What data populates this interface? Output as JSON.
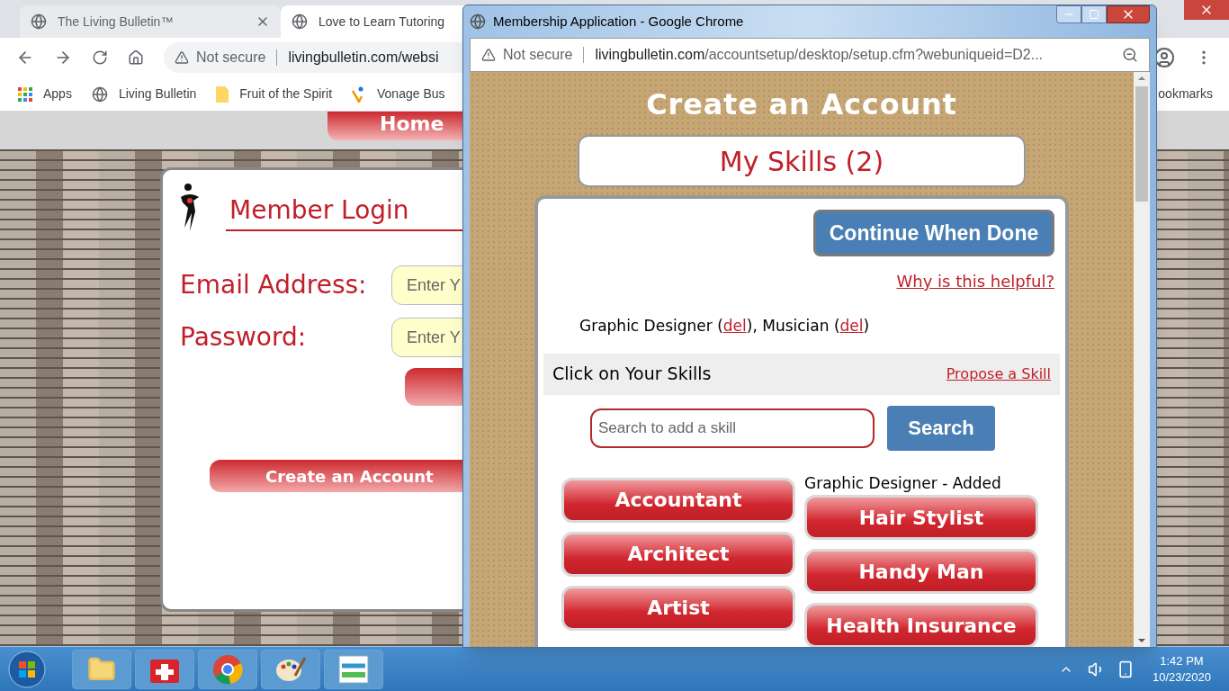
{
  "background_browser": {
    "tabs": [
      {
        "title": "The Living Bulletin™",
        "selected": false
      },
      {
        "title": "Love to Learn Tutoring",
        "selected": true
      }
    ],
    "address_bar": {
      "security": "Not secure",
      "url": "livingbulletin.com/websi"
    },
    "bookmarks": [
      {
        "label": "Apps",
        "kind": "apps"
      },
      {
        "label": "Living Bulletin",
        "kind": "globe"
      },
      {
        "label": "Fruit of the Spirit",
        "kind": "folder"
      },
      {
        "label": "Vonage Bus",
        "kind": "vonage"
      }
    ],
    "other_bookmarks": "ookmarks"
  },
  "background_page": {
    "nav_tab": "Home",
    "login": {
      "title": "Member Login",
      "fields": [
        {
          "label": "Email Address:",
          "placeholder": "Enter Y"
        },
        {
          "label": "Password:",
          "placeholder": "Enter Y"
        }
      ],
      "create_button": "Create an Account"
    }
  },
  "popup": {
    "title": "Membership Application - Google Chrome",
    "address_bar": {
      "security": "Not secure",
      "host": "livingbulletin.com",
      "path": "/accountsetup/desktop/setup.cfm?webuniqueid=D2..."
    },
    "heading": "Create an Account",
    "section_title": "My Skills (2)",
    "continue_button": "Continue When Done",
    "help_link": "Why is this helpful?",
    "selected_skills": [
      {
        "kind": "text",
        "text": "Graphic Designer ("
      },
      {
        "kind": "link",
        "text": "del"
      },
      {
        "kind": "text",
        "text": "), Musician ("
      },
      {
        "kind": "link",
        "text": "del"
      },
      {
        "kind": "text",
        "text": ")"
      }
    ],
    "skills_bar": {
      "label": "Click on Your Skills",
      "link": "Propose a Skill"
    },
    "search": {
      "placeholder": "Search to add a skill",
      "button": "Search"
    },
    "skill_columns": [
      {
        "items": [
          "Accountant",
          "Architect",
          "Artist"
        ]
      },
      {
        "note": "Graphic Designer - Added",
        "items": [
          "Hair Stylist",
          "Handy Man",
          "Health Insurance"
        ]
      }
    ]
  },
  "taskbar": {
    "time": "1:42 PM",
    "date": "10/23/2020"
  }
}
